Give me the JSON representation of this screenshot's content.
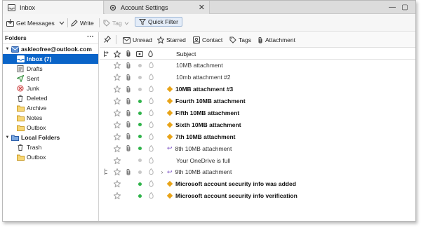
{
  "tabs": [
    {
      "label": "Inbox",
      "icon": "inbox-icon",
      "active": true
    },
    {
      "label": "Account Settings",
      "icon": "gear-icon",
      "active": false
    }
  ],
  "toolbar": {
    "get_messages": "Get Messages",
    "write": "Write",
    "tag": "Tag",
    "quick_filter": "Quick Filter"
  },
  "folders": {
    "header": "Folders",
    "menu": "···",
    "account": "askleofree@outlook.com",
    "items": [
      {
        "label": "Inbox (7)",
        "icon": "inbox-icon",
        "selected": true
      },
      {
        "label": "Drafts",
        "icon": "drafts-icon"
      },
      {
        "label": "Sent",
        "icon": "sent-icon"
      },
      {
        "label": "Junk",
        "icon": "junk-icon"
      },
      {
        "label": "Deleted",
        "icon": "trash-icon"
      },
      {
        "label": "Archive",
        "icon": "folder-icon"
      },
      {
        "label": "Notes",
        "icon": "folder-icon"
      },
      {
        "label": "Outbox",
        "icon": "folder-icon"
      }
    ],
    "local": "Local Folders",
    "local_items": [
      {
        "label": "Trash",
        "icon": "trash-icon"
      },
      {
        "label": "Outbox",
        "icon": "folder-icon"
      }
    ]
  },
  "quick_filter": {
    "unread": "Unread",
    "starred": "Starred",
    "contact": "Contact",
    "tags": "Tags",
    "attachment": "Attachment"
  },
  "message_list": {
    "subject_header": "Subject",
    "messages": [
      {
        "subject": "10MB attachment",
        "unread": false,
        "green": false,
        "attach": true,
        "reply": false
      },
      {
        "subject": "10mb attachment #2",
        "unread": false,
        "green": false,
        "attach": true,
        "reply": false
      },
      {
        "subject": "10MB attachment #3",
        "unread": true,
        "green": false,
        "attach": true,
        "reply": false
      },
      {
        "subject": "Fourth 10MB attachment",
        "unread": true,
        "green": true,
        "attach": true,
        "reply": false
      },
      {
        "subject": "Fifth 10MB attachment",
        "unread": true,
        "green": true,
        "attach": true,
        "reply": false
      },
      {
        "subject": "Sixth 10MB attachment",
        "unread": true,
        "green": true,
        "attach": true,
        "reply": false
      },
      {
        "subject": "7th 10MB attachment",
        "unread": true,
        "green": true,
        "attach": true,
        "reply": false
      },
      {
        "subject": "8th 10MB attachment",
        "unread": false,
        "green": true,
        "attach": true,
        "reply": true
      },
      {
        "subject": "Your OneDrive is full",
        "unread": false,
        "green": false,
        "attach": false,
        "reply": false
      },
      {
        "subject": "9th 10MB attachment",
        "unread": false,
        "green": false,
        "attach": true,
        "reply": true,
        "thread": true
      },
      {
        "subject": "Microsoft account security info was added",
        "unread": true,
        "green": true,
        "attach": false,
        "reply": false
      },
      {
        "subject": "Microsoft account security info verification",
        "unread": true,
        "green": true,
        "attach": false,
        "reply": false
      }
    ]
  },
  "colors": {
    "selection": "#0a64c8",
    "unread_diamond": "#e8a317",
    "online_dot": "#2fb34a",
    "reply_arrow": "#7a4fc4"
  }
}
